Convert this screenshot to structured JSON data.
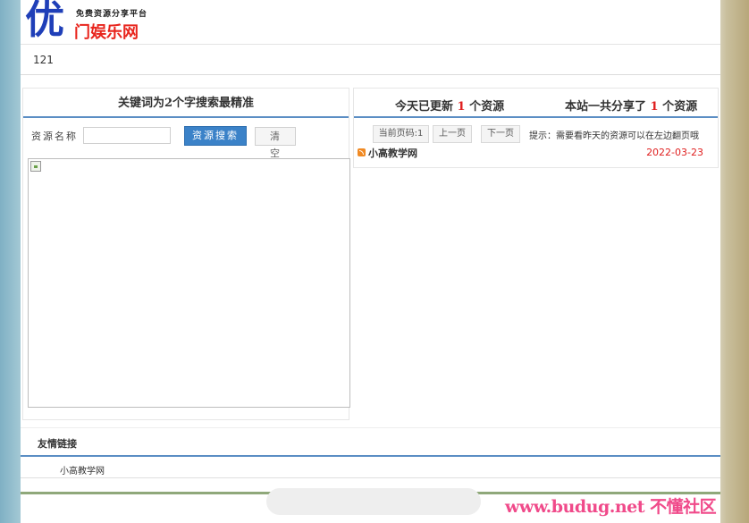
{
  "header": {
    "logo_big": "优",
    "logo_tagline": "免费资源分享平台",
    "logo_name": "门娱乐网"
  },
  "subnav": {
    "text": "121"
  },
  "search_panel": {
    "title": "关键词为2个字搜索最精准",
    "label": "资源名称",
    "input_value": "",
    "search_button": "资源搜索",
    "clear_button": "清 空"
  },
  "resources_panel": {
    "today_prefix": "今天已更新",
    "today_count": "1",
    "today_suffix": "个资源",
    "total_prefix": "本站一共分享了",
    "total_count": "1",
    "total_suffix": "个资源",
    "pager": {
      "current": "当前页码:1",
      "prev": "上一页",
      "next": "下一页",
      "hint": "提示：需要看昨天的资源可以在左边翻页哦"
    },
    "items": [
      {
        "title": "小高教学网",
        "date": "2022-03-23"
      }
    ]
  },
  "friends": {
    "title": "友情链接",
    "links": [
      "小高教学网"
    ]
  },
  "watermark": "www.budug.net 不懂社区",
  "colors": {
    "accent_blue": "#3b82c8",
    "rule_blue": "#5b8ec4",
    "red": "#e02020",
    "logo_blue": "#1f3fb8",
    "logo_red": "#e8251d"
  },
  "icons": [
    "broken-image-icon",
    "rss-icon"
  ]
}
